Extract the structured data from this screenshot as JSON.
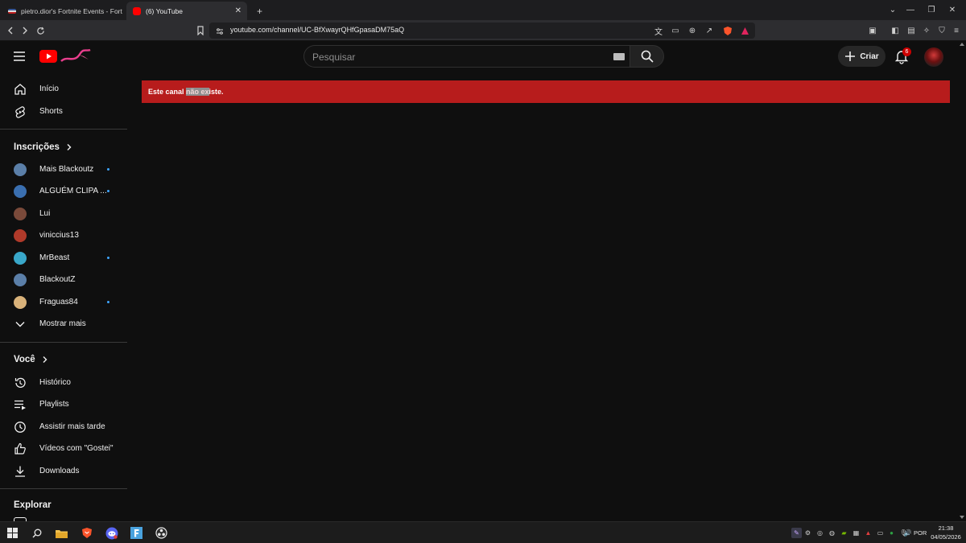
{
  "browser": {
    "tabs": [
      {
        "title": "pietro.dior's Fortnite Events - Fortnite",
        "active": false
      },
      {
        "title": "(6) YouTube",
        "active": true
      }
    ],
    "new_tab_label": "+",
    "url": "youtube.com/channel/UC-BfXwayrQHfGpasaDM75aQ"
  },
  "masthead": {
    "search_placeholder": "Pesquisar",
    "create_label": "Criar",
    "notification_count": "6"
  },
  "sidebar": {
    "main_items": [
      {
        "label": "Início",
        "icon": "home-icon"
      },
      {
        "label": "Shorts",
        "icon": "shorts-icon"
      }
    ],
    "subscriptions_title": "Inscrições",
    "subscriptions": [
      {
        "label": "Mais Blackoutz",
        "new": true,
        "color": "#5b7fa8"
      },
      {
        "label": "ALGUÉM CLIPA ...",
        "new": true,
        "color": "#3a6fb0"
      },
      {
        "label": "Lui",
        "new": false,
        "color": "#7a4a3a"
      },
      {
        "label": "viniccius13",
        "new": false,
        "color": "#b03a2a"
      },
      {
        "label": "MrBeast",
        "new": true,
        "color": "#39a7c9"
      },
      {
        "label": "BlackoutZ",
        "new": false,
        "color": "#5b7fa8"
      },
      {
        "label": "Fraguas84",
        "new": true,
        "color": "#d9b27a"
      }
    ],
    "show_more_label": "Mostrar mais",
    "you_title": "Você",
    "you_items": [
      {
        "label": "Histórico",
        "icon": "history-icon"
      },
      {
        "label": "Playlists",
        "icon": "playlists-icon"
      },
      {
        "label": "Assistir mais tarde",
        "icon": "watch-later-icon"
      },
      {
        "label": "Vídeos com \"Gostei\"",
        "icon": "like-icon"
      },
      {
        "label": "Downloads",
        "icon": "download-icon"
      }
    ],
    "explore_title": "Explorar"
  },
  "main": {
    "banner_before": "Este canal ",
    "banner_highlight": "não ex",
    "banner_after": "iste."
  },
  "taskbar": {
    "language": "POR",
    "time": "21:38",
    "date": "04/05/2026"
  },
  "colors": {
    "banner": "#b71c1c",
    "youtube_red": "#ff0000",
    "background": "#0f0f0f"
  }
}
